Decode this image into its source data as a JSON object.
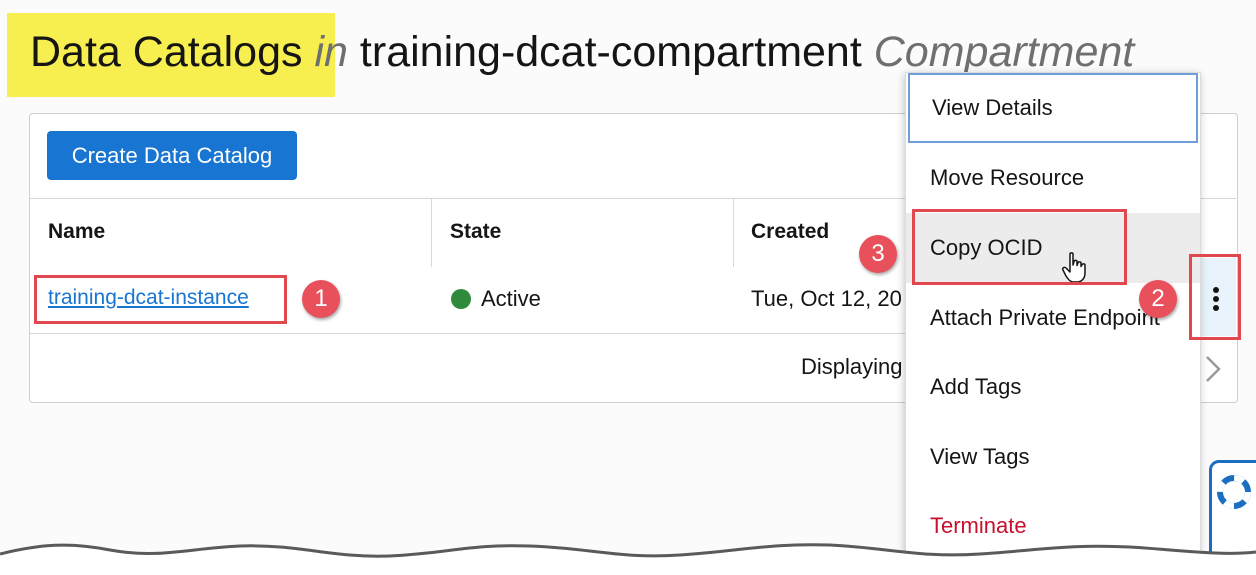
{
  "header": {
    "title": "Data Catalogs",
    "connector": "in",
    "compartment": "training-dcat-compartment",
    "compartment_suffix": "Compartment"
  },
  "toolbar": {
    "create_label": "Create Data Catalog"
  },
  "table": {
    "columns": [
      "Name",
      "State",
      "Created"
    ],
    "rows": [
      {
        "name": "training-dcat-instance",
        "state": "Active",
        "created": "Tue, Oct 12, 20"
      }
    ],
    "paging_text": "Displaying"
  },
  "action_menu": {
    "items": [
      {
        "label": "View Details"
      },
      {
        "label": "Move Resource"
      },
      {
        "label": "Copy OCID"
      },
      {
        "label": "Attach Private Endpoint"
      },
      {
        "label": "Add Tags"
      },
      {
        "label": "View Tags"
      },
      {
        "label": "Terminate"
      }
    ]
  },
  "annotations": {
    "step1": "1",
    "step2": "2",
    "step3": "3"
  },
  "colors": {
    "accent": "#1875d1",
    "highlight": "#f7ef4f",
    "active": "#2f8a3c",
    "danger": "#c8102e",
    "annotation": "#e0474f"
  },
  "icons": {
    "row_actions": "kebab-icon",
    "next_page": "chevron-right-icon",
    "pointer": "hand-cursor-icon",
    "help": "lifebuoy-icon"
  }
}
